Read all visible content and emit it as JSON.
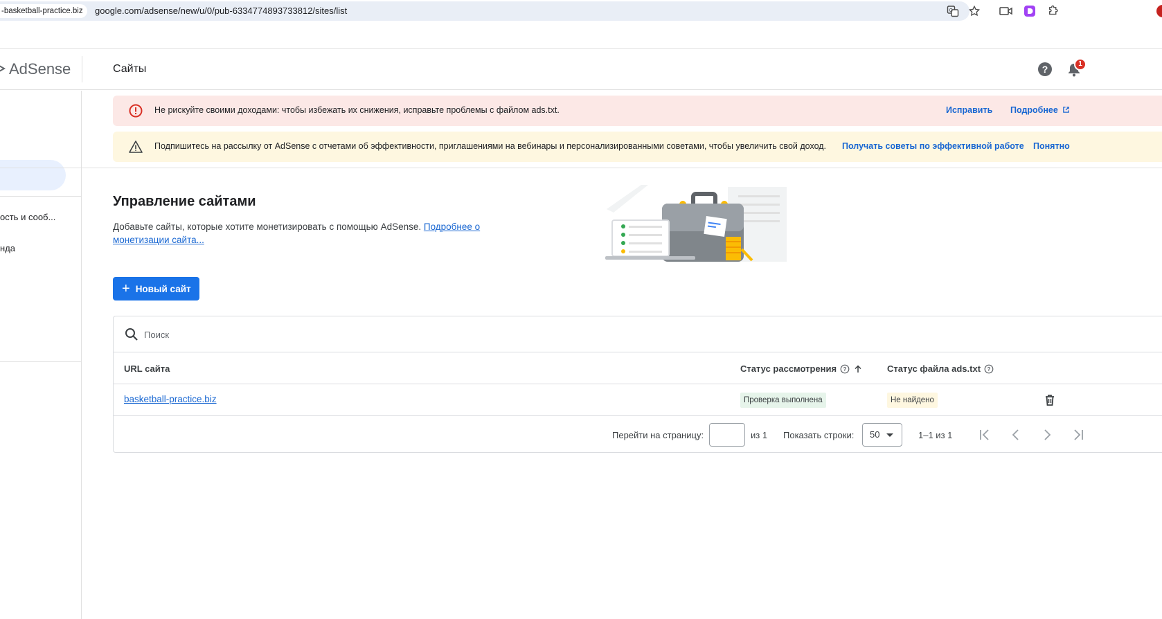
{
  "browser": {
    "tab_site": "-basketball-practice.biz",
    "url": "google.com/adsense/new/u/0/pub-6334774893733812/sites/list"
  },
  "header": {
    "logo": "AdSense",
    "title": "Сайты",
    "notification_count": "1"
  },
  "sidebar": {
    "items": [
      {
        "label": "ость и сооб..."
      },
      {
        "label": "нда"
      }
    ]
  },
  "banners": {
    "error": {
      "text": "Не рискуйте своими доходами: чтобы избежать их снижения, исправьте проблемы с файлом ads.txt.",
      "fix_label": "Исправить",
      "more_label": "Подробнее"
    },
    "info": {
      "text": "Подпишитесь на рассылку от AdSense с отчетами об эффективности, приглашениями на вебинары и персонализированными советами, чтобы увеличить свой доход.",
      "tips_label": "Получать советы по эффективной работе",
      "ok_label": "Понятно"
    }
  },
  "manage": {
    "title": "Управление сайтами",
    "description": "Добавьте сайты, которые хотите монетизировать с помощью AdSense.",
    "link": "Подробнее о монетизации сайта...",
    "new_site_label": "Новый сайт"
  },
  "table": {
    "search_placeholder": "Поиск",
    "columns": {
      "url": "URL сайта",
      "review_status": "Статус рассмотрения",
      "ads_txt_status": "Статус файла ads.txt"
    },
    "rows": [
      {
        "url": "basketball-practice.biz",
        "review_status": "Проверка выполнена",
        "ads_txt_status": "Не найдено"
      }
    ]
  },
  "pagination": {
    "goto_label": "Перейти на страницу:",
    "of_label": "из 1",
    "rows_label": "Показать строки:",
    "rows_value": "50",
    "range": "1–1 из 1"
  },
  "colors": {
    "primary": "#1a73e8",
    "error_bg": "#fce8e6",
    "info_bg": "#fef7e0",
    "success_chip": "#e6f4ea"
  }
}
